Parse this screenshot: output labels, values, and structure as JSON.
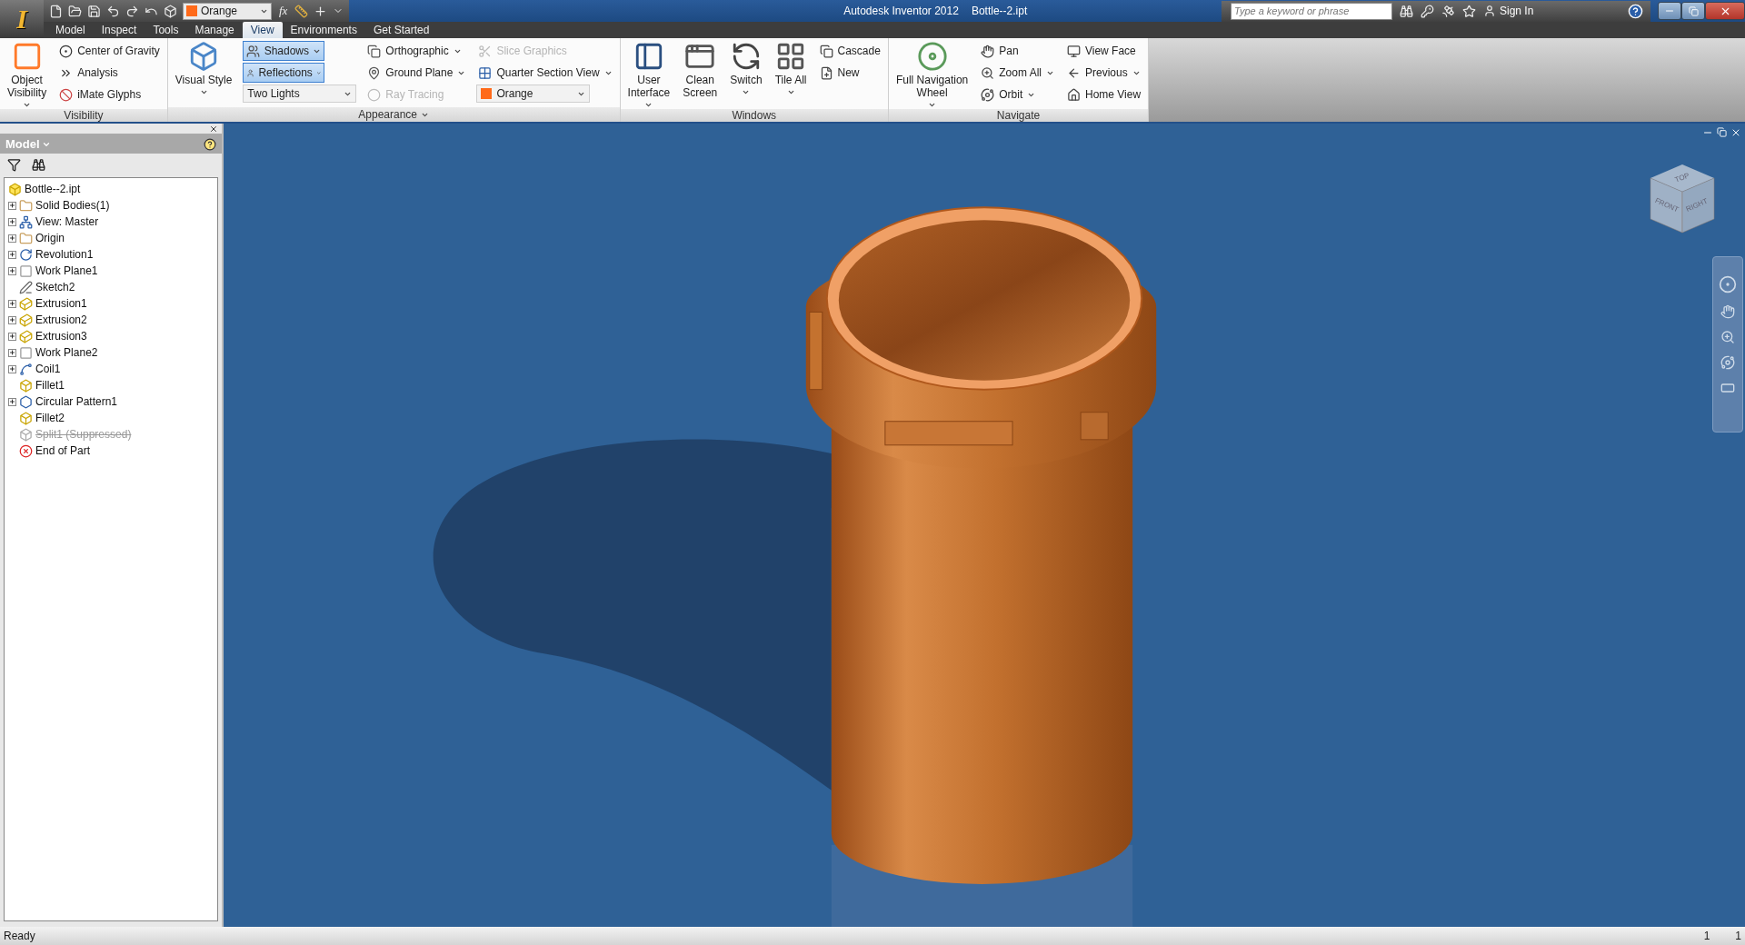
{
  "app_button": {
    "label": "I"
  },
  "quick_access": {
    "material": {
      "label": "Orange",
      "color": "#ff6a1a"
    },
    "formula": {
      "label": "fx"
    }
  },
  "title": {
    "app": "Autodesk Inventor 2012",
    "document": "Bottle--2.ipt"
  },
  "search": {
    "placeholder": "Type a keyword or phrase",
    "sign_in": "Sign In"
  },
  "tabs": [
    {
      "label": "Model",
      "selected": false
    },
    {
      "label": "Inspect",
      "selected": false
    },
    {
      "label": "Tools",
      "selected": false
    },
    {
      "label": "Manage",
      "selected": false
    },
    {
      "label": "View",
      "selected": true
    },
    {
      "label": "Environments",
      "selected": false
    },
    {
      "label": "Get Started",
      "selected": false
    }
  ],
  "ribbon": [
    {
      "title": "Visibility",
      "has_menu": false,
      "columns": [
        {
          "kind": "large",
          "label": "Object\nVisibility",
          "has_menu": true
        },
        {
          "kind": "stack",
          "items": [
            {
              "kind": "small",
              "label": "Center of Gravity",
              "disabled": false,
              "has_menu": false
            },
            {
              "kind": "small",
              "label": "Analysis",
              "disabled": false,
              "has_menu": false
            },
            {
              "kind": "small",
              "label": "iMate Glyphs",
              "disabled": false,
              "has_menu": false
            }
          ]
        }
      ]
    },
    {
      "title": "Appearance",
      "has_menu": true,
      "columns": [
        {
          "kind": "large",
          "label": "Visual Style",
          "has_menu": true
        },
        {
          "kind": "stack",
          "items": [
            {
              "kind": "toggle",
              "label": "Shadows",
              "on": true
            },
            {
              "kind": "toggle",
              "label": "Reflections",
              "on": true
            },
            {
              "kind": "combo",
              "label": "Two Lights"
            }
          ]
        },
        {
          "kind": "stack",
          "items": [
            {
              "kind": "small",
              "label": "Orthographic",
              "disabled": false,
              "has_menu": true
            },
            {
              "kind": "small",
              "label": "Ground Plane",
              "disabled": false,
              "has_menu": true
            },
            {
              "kind": "small",
              "label": "Ray Tracing",
              "disabled": true,
              "has_menu": false
            }
          ]
        },
        {
          "kind": "stack",
          "items": [
            {
              "kind": "small",
              "label": "Slice Graphics",
              "disabled": true,
              "has_menu": false
            },
            {
              "kind": "small",
              "label": "Quarter Section View",
              "disabled": false,
              "has_menu": true
            },
            {
              "kind": "combo",
              "label": "Orange",
              "color": "#ff6a1a"
            }
          ]
        }
      ]
    },
    {
      "title": "Windows",
      "has_menu": false,
      "columns": [
        {
          "kind": "large",
          "label": "User\nInterface",
          "has_menu": true
        },
        {
          "kind": "large",
          "label": "Clean\nScreen",
          "has_menu": false
        },
        {
          "kind": "large",
          "label": "Switch",
          "has_menu": true
        },
        {
          "kind": "large",
          "label": "Tile All",
          "has_menu": true
        },
        {
          "kind": "stack",
          "items": [
            {
              "kind": "small",
              "label": "Cascade",
              "disabled": false,
              "has_menu": false
            },
            {
              "kind": "small",
              "label": "New",
              "disabled": false,
              "has_menu": false
            }
          ]
        }
      ]
    },
    {
      "title": "Navigate",
      "has_menu": false,
      "columns": [
        {
          "kind": "large",
          "label": "Full Navigation\nWheel",
          "has_menu": true
        },
        {
          "kind": "stack",
          "items": [
            {
              "kind": "small",
              "label": "Pan",
              "disabled": false,
              "has_menu": false
            },
            {
              "kind": "small",
              "label": "Zoom All",
              "disabled": false,
              "has_menu": true
            },
            {
              "kind": "small",
              "label": "Orbit",
              "disabled": false,
              "has_menu": true
            }
          ]
        },
        {
          "kind": "stack",
          "items": [
            {
              "kind": "small",
              "label": "View Face",
              "disabled": false,
              "has_menu": false
            },
            {
              "kind": "small",
              "label": "Previous",
              "disabled": false,
              "has_menu": true
            },
            {
              "kind": "small",
              "label": "Home View",
              "disabled": false,
              "has_menu": false
            }
          ]
        }
      ]
    }
  ],
  "browser": {
    "title": "Model",
    "root": "Bottle--2.ipt",
    "items": [
      {
        "label": "Solid Bodies(1)",
        "expandable": true,
        "suppressed": false
      },
      {
        "label": "View: Master",
        "expandable": true,
        "suppressed": false
      },
      {
        "label": "Origin",
        "expandable": true,
        "suppressed": false
      },
      {
        "label": "Revolution1",
        "expandable": true,
        "suppressed": false
      },
      {
        "label": "Work Plane1",
        "expandable": true,
        "suppressed": false
      },
      {
        "label": "Sketch2",
        "expandable": false,
        "suppressed": false
      },
      {
        "label": "Extrusion1",
        "expandable": true,
        "suppressed": false
      },
      {
        "label": "Extrusion2",
        "expandable": true,
        "suppressed": false
      },
      {
        "label": "Extrusion3",
        "expandable": true,
        "suppressed": false
      },
      {
        "label": "Work Plane2",
        "expandable": true,
        "suppressed": false
      },
      {
        "label": "Coil1",
        "expandable": true,
        "suppressed": false
      },
      {
        "label": "Fillet1",
        "expandable": false,
        "suppressed": false
      },
      {
        "label": "Circular Pattern1",
        "expandable": true,
        "suppressed": false
      },
      {
        "label": "Fillet2",
        "expandable": false,
        "suppressed": false
      },
      {
        "label": "Split1 (Suppressed)",
        "expandable": false,
        "suppressed": true
      },
      {
        "label": "End of Part",
        "expandable": false,
        "suppressed": false
      }
    ]
  },
  "view_cube": {
    "top": "TOP",
    "front": "FRONT",
    "right": "RIGHT"
  },
  "status_bar": {
    "message": "Ready",
    "field_1": "1",
    "field_2": "1"
  }
}
